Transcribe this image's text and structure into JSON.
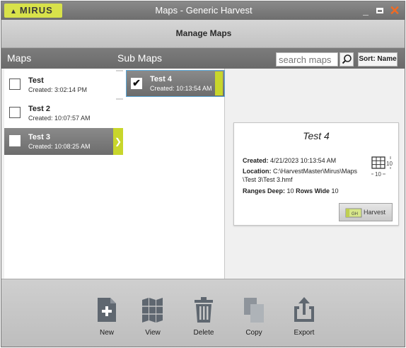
{
  "window": {
    "title": "Maps - Generic Harvest",
    "logo_text": "MIRUS",
    "minimize": "_",
    "close": "✕"
  },
  "header": {
    "title": "Manage Maps"
  },
  "section": {
    "maps_label": "Maps",
    "submaps_label": "Sub Maps",
    "search_placeholder": "search maps",
    "sort_label": "Sort: Name"
  },
  "maps": [
    {
      "name": "Test",
      "created": "Created:  3:02:14 PM",
      "checked": false,
      "selected": false
    },
    {
      "name": "Test 2",
      "created": "Created:  10:07:57 AM",
      "checked": false,
      "selected": false
    },
    {
      "name": "Test 3",
      "created": "Created:  10:08:25 AM",
      "checked": false,
      "selected": true
    }
  ],
  "submaps": [
    {
      "name": "Test 4",
      "created": "Created:  10:13:54 AM",
      "checked": true,
      "selected": true
    }
  ],
  "detail": {
    "title": "Test 4",
    "created_label": "Created:",
    "created_value": "4/21/2023 10:13:54 AM",
    "location_label": "Location:",
    "location_line1": "C:\\HarvestMaster\\Mirus\\Maps",
    "location_line2": "\\Test 3\\Test 3.hmf",
    "ranges_label": "Ranges Deep:",
    "ranges_value": "10",
    "rows_label": "Rows Wide",
    "rows_value": "10",
    "grid_right_value": "10",
    "grid_bottom_value": "10",
    "harvest_label": "Harvest",
    "harvest_icon_text": "GH"
  },
  "toolbar": {
    "new_label": "New",
    "view_label": "View",
    "delete_label": "Delete",
    "copy_label": "Copy",
    "export_label": "Export"
  },
  "colors": {
    "accent": "#c8d62b",
    "close": "#f26a22",
    "selected_row": "#7a7a7a",
    "icon_gray": "#5f6770"
  }
}
